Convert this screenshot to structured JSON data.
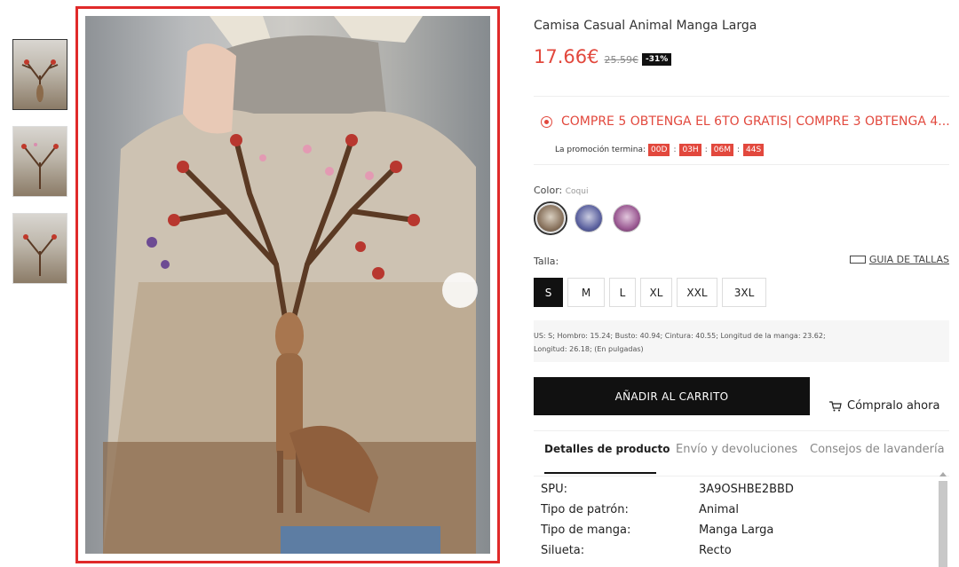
{
  "product": {
    "title": "Camisa Casual Animal Manga Larga",
    "price": "17.66€",
    "original_price": "25.59€",
    "discount": "-31%"
  },
  "promo": {
    "headline": "COMPRE 5 OBTENGA EL 6TO GRATIS| COMPRE 3 OBTENGA 4...",
    "timer_label": "La promoción termina:",
    "days": "00D",
    "hours": "03H",
    "minutes": "06M",
    "seconds": "44S"
  },
  "color": {
    "label": "Color:",
    "selected": "Coqui",
    "swatches": [
      "coqui",
      "blue",
      "purple"
    ]
  },
  "size": {
    "label": "Talla:",
    "guide": "GUIA DE TALLAS",
    "options": [
      "S",
      "M",
      "L",
      "XL",
      "XXL",
      "3XL"
    ],
    "selected": "S"
  },
  "measurements": {
    "line1": "US: S;  Hombro: 15.24;  Busto: 40.94;  Cintura: 40.55;  Longitud de la manga: 23.62;",
    "line2": "Longitud: 26.18;  (En pulgadas)"
  },
  "actions": {
    "add_to_cart": "AÑADIR AL CARRITO",
    "buy_now": "Cómpralo ahora"
  },
  "tabs": [
    "Detalles de producto",
    "Envío y devoluciones",
    "Consejos de lavandería"
  ],
  "details": [
    {
      "key": "SPU:",
      "value": "3A9OSHBE2BBD"
    },
    {
      "key": "Tipo de patrón:",
      "value": "Animal"
    },
    {
      "key": "Tipo de manga:",
      "value": "Manga Larga"
    },
    {
      "key": "Silueta:",
      "value": "Recto"
    }
  ],
  "colors": {
    "accent": "#e2483d",
    "frame": "#e02a2a",
    "button": "#111111"
  }
}
